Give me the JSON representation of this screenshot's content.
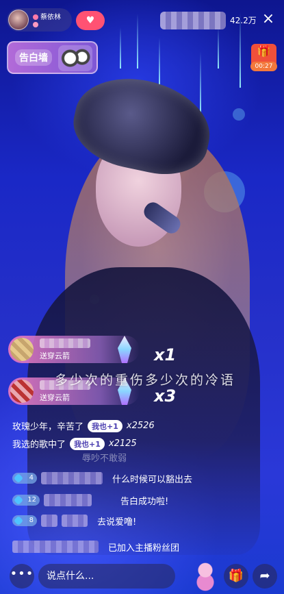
{
  "header": {
    "anchor_name": "蔡依林",
    "follow_icon": "heart-plus-icon",
    "viewer_count": "42.2万",
    "close_icon": "close-icon"
  },
  "confess_wall": {
    "label": "告白墙"
  },
  "timer_badge": {
    "time": "00:27"
  },
  "gift_banners": [
    {
      "gift_text": "送穿云箭",
      "combo": "x1"
    },
    {
      "gift_text": "送穿云箭",
      "combo": "x3"
    }
  ],
  "lyric": "多少次的重伤多少次的冷语",
  "chat_lines": [
    {
      "text": "玫瑰少年，辛苦了",
      "me_too": "我也+1",
      "count": "x2526"
    },
    {
      "text": "我选的歌中了",
      "me_too": "我也+1",
      "count": "x2125"
    }
  ],
  "faded_line": "辱吵不敢弱",
  "messages": [
    {
      "level": "4",
      "text": "什么时候可以豁出去"
    },
    {
      "level": "12",
      "text": "告白成功啦!"
    },
    {
      "level": "8",
      "text": "去说爱噜!"
    },
    {
      "level": "",
      "text": "已加入主播粉丝团"
    }
  ],
  "bottom": {
    "input_placeholder": "说点什么...",
    "more_label": "•••"
  },
  "colors": {
    "follow": "#ff5273",
    "timer": "#f0503a",
    "accent": "#b26ad8"
  }
}
